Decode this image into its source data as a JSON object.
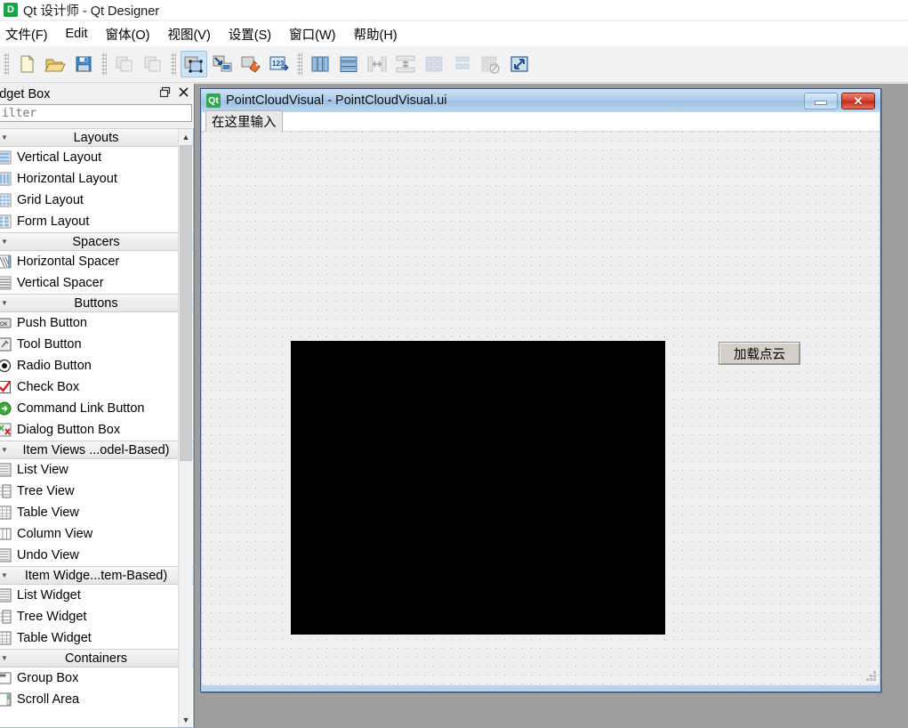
{
  "window": {
    "app_icon": "qt-designer-icon",
    "title": "Qt 设计师 - Qt Designer"
  },
  "menubar": {
    "items": [
      {
        "label": "文件(F)",
        "name": "menu-file"
      },
      {
        "label": "Edit",
        "name": "menu-edit"
      },
      {
        "label": "窗体(O)",
        "name": "menu-form"
      },
      {
        "label": "视图(V)",
        "name": "menu-view"
      },
      {
        "label": "设置(S)",
        "name": "menu-settings"
      },
      {
        "label": "窗口(W)",
        "name": "menu-window"
      },
      {
        "label": "帮助(H)",
        "name": "menu-help"
      }
    ]
  },
  "toolbar": {
    "groups": [
      {
        "name": "file-group",
        "buttons": [
          {
            "name": "new-form-button",
            "icon": "new-file-icon",
            "state": "enabled"
          },
          {
            "name": "open-form-button",
            "icon": "open-folder-icon",
            "state": "enabled"
          },
          {
            "name": "save-form-button",
            "icon": "save-floppy-icon",
            "state": "enabled"
          }
        ]
      },
      {
        "name": "edit-group",
        "buttons": [
          {
            "name": "undo-button",
            "icon": "copy-stack-icon",
            "state": "disabled"
          },
          {
            "name": "redo-button",
            "icon": "copy-stack-icon",
            "state": "disabled"
          }
        ]
      },
      {
        "name": "mode-group",
        "buttons": [
          {
            "name": "edit-widgets-button",
            "icon": "edit-widgets-icon",
            "state": "active"
          },
          {
            "name": "edit-signals-slots-button",
            "icon": "signals-slots-icon",
            "state": "enabled"
          },
          {
            "name": "edit-buddies-button",
            "icon": "buddies-icon",
            "state": "enabled"
          },
          {
            "name": "edit-tab-order-button",
            "icon": "tab-order-icon",
            "state": "enabled"
          }
        ]
      },
      {
        "name": "layout-group",
        "buttons": [
          {
            "name": "layout-horizontally-button",
            "icon": "layout-horizontal-icon",
            "state": "enabled"
          },
          {
            "name": "layout-vertically-button",
            "icon": "layout-vertical-icon",
            "state": "enabled"
          },
          {
            "name": "layout-splitter-horizontal-button",
            "icon": "splitter-horizontal-icon",
            "state": "disabled"
          },
          {
            "name": "layout-splitter-vertical-button",
            "icon": "splitter-vertical-icon",
            "state": "disabled"
          },
          {
            "name": "layout-grid-button",
            "icon": "layout-grid-icon",
            "state": "disabled"
          },
          {
            "name": "layout-form-button",
            "icon": "layout-form-icon",
            "state": "disabled"
          },
          {
            "name": "break-layout-button",
            "icon": "break-layout-icon",
            "state": "disabled"
          },
          {
            "name": "adjust-size-button",
            "icon": "adjust-size-icon",
            "state": "enabled"
          }
        ]
      }
    ]
  },
  "widget_box": {
    "title": "Widget Box",
    "title_clipped": "idget Box",
    "header_buttons": [
      {
        "name": "float-dock-button",
        "icon": "float-window-icon"
      },
      {
        "name": "close-dock-button",
        "icon": "close-icon"
      }
    ],
    "filter": {
      "value": "",
      "placeholder": "Filter",
      "placeholder_clipped": "ilter"
    },
    "scrollbar": {
      "up_arrow": "chevron-up-icon",
      "down_arrow": "chevron-down-icon"
    },
    "sections": [
      {
        "name": "section-layouts",
        "title": "Layouts",
        "items": [
          {
            "label": "Vertical Layout",
            "icon": "vertical-layout-icon"
          },
          {
            "label": "Horizontal Layout",
            "icon": "horizontal-layout-icon"
          },
          {
            "label": "Grid Layout",
            "icon": "grid-layout-icon"
          },
          {
            "label": "Form Layout",
            "icon": "form-layout-icon"
          }
        ]
      },
      {
        "name": "section-spacers",
        "title": "Spacers",
        "items": [
          {
            "label": "Horizontal Spacer",
            "icon": "horizontal-spacer-icon"
          },
          {
            "label": "Vertical Spacer",
            "icon": "vertical-spacer-icon"
          }
        ]
      },
      {
        "name": "section-buttons",
        "title": "Buttons",
        "items": [
          {
            "label": "Push Button",
            "icon": "push-button-icon"
          },
          {
            "label": "Tool Button",
            "icon": "tool-button-icon"
          },
          {
            "label": "Radio Button",
            "icon": "radio-button-icon"
          },
          {
            "label": "Check Box",
            "icon": "check-box-icon"
          },
          {
            "label": "Command Link Button",
            "icon": "command-link-icon"
          },
          {
            "label": "Dialog Button Box",
            "icon": "dialog-button-box-icon"
          }
        ]
      },
      {
        "name": "section-item-views",
        "title": "Item Views ...odel-Based)",
        "items": [
          {
            "label": "List View",
            "icon": "list-view-icon"
          },
          {
            "label": "Tree View",
            "icon": "tree-view-icon"
          },
          {
            "label": "Table View",
            "icon": "table-view-icon"
          },
          {
            "label": "Column View",
            "icon": "column-view-icon"
          },
          {
            "label": "Undo View",
            "icon": "undo-view-icon"
          }
        ]
      },
      {
        "name": "section-item-widgets",
        "title": "Item Widge...tem-Based)",
        "items": [
          {
            "label": "List Widget",
            "icon": "list-widget-icon"
          },
          {
            "label": "Tree Widget",
            "icon": "tree-widget-icon"
          },
          {
            "label": "Table Widget",
            "icon": "table-widget-icon"
          }
        ]
      },
      {
        "name": "section-containers",
        "title": "Containers",
        "items": [
          {
            "label": "Group Box",
            "icon": "group-box-icon"
          },
          {
            "label": "Scroll Area",
            "icon": "scroll-area-icon"
          }
        ]
      }
    ]
  },
  "mdi": {
    "child_window": {
      "icon": "qt-icon",
      "icon_text": "Qt",
      "title": "PointCloudVisual - PointCloudVisual.ui",
      "buttons": [
        {
          "name": "minimize-button",
          "icon": "minimize-icon"
        },
        {
          "name": "close-button",
          "icon": "close-icon",
          "glyph": "✕"
        }
      ],
      "form": {
        "menubar_placeholder": "在这里输入",
        "widgets": [
          {
            "name": "pointcloud-display-widget",
            "type": "QWidget",
            "color": "#000000"
          },
          {
            "name": "load-pointcloud-button",
            "type": "QPushButton",
            "label": "加载点云"
          }
        ],
        "resize_grip": "resize-grip-icon"
      }
    }
  },
  "colors": {
    "accent": "#9dc0e4",
    "mdi_background": "#9e9e9e",
    "form_canvas": "#efefef",
    "toolbar_active": "#cde4f7",
    "close_button": "#d4432c",
    "qt_green": "#2fa84f"
  }
}
